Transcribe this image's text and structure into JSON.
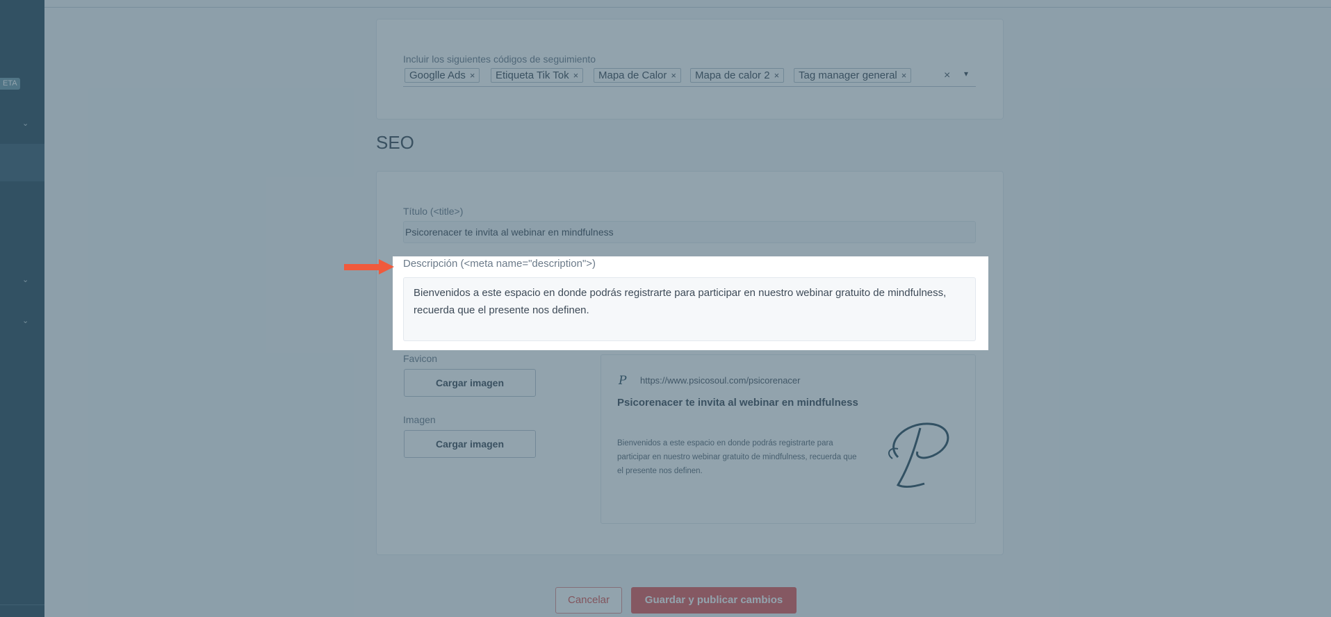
{
  "sidebar": {
    "badge": "ETA"
  },
  "tracking": {
    "label": "Incluir los siguientes códigos de seguimiento",
    "tags": [
      "Googlle Ads",
      "Etiqueta Tik Tok",
      "Mapa de Calor",
      "Mapa de calor 2",
      "Tag manager general"
    ],
    "remove_glyph": "×",
    "clear_glyph": "×",
    "caret_glyph": "▾"
  },
  "seo": {
    "heading": "SEO",
    "title_label": "Título (<title>)",
    "title_value": "Psicorenacer te invita al webinar en mindfulness",
    "description_label": "Descripción (<meta name=\"description\">)",
    "description_value": "Bienvenidos a este espacio en donde podrás registrarte para participar en nuestro webinar gratuito de mindfulness, recuerda que el presente nos definen.",
    "favicon_label": "Favicon",
    "favicon_button": "Cargar imagen",
    "image_label": "Imagen",
    "image_button": "Cargar imagen",
    "preview": {
      "url": "https://www.psicosoul.com/psicorenacer",
      "title": "Psicorenacer te invita al webinar en mindfulness",
      "description": "Bienvenidos a este espacio en donde podrás registrarte para participar en nuestro webinar gratuito de mindfulness, recuerda que el presente nos definen.",
      "favicon_glyph": "P"
    }
  },
  "actions": {
    "cancel": "Cancelar",
    "save": "Guardar y publicar cambios"
  },
  "colors": {
    "sidebar": "#2c4a5c",
    "accent_red": "#e35a5a",
    "arrow": "#f05a3c"
  }
}
